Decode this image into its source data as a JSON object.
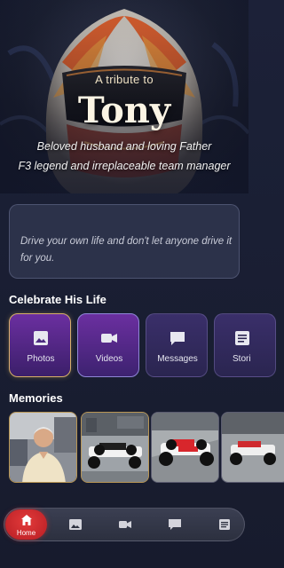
{
  "hero": {
    "kicker": "A tribute to",
    "name": "Tony",
    "line1": "Beloved husband and loving Father",
    "line2": "F3 legend and irreplaceable team manager"
  },
  "quote": {
    "text": "Drive your own life and don't let anyone drive it for you."
  },
  "celebrate": {
    "title": "Celebrate His Life",
    "tiles": [
      {
        "label": "Photos",
        "icon": "photo-icon"
      },
      {
        "label": "Videos",
        "icon": "video-icon"
      },
      {
        "label": "Messages",
        "icon": "message-icon"
      },
      {
        "label": "Stori",
        "icon": "stories-icon"
      }
    ]
  },
  "memories": {
    "title": "Memories",
    "items": [
      {
        "icon": "portrait-photo"
      },
      {
        "icon": "race-car-photo"
      },
      {
        "icon": "race-car-photo"
      },
      {
        "icon": "race-car-photo"
      }
    ]
  },
  "nav": {
    "home_label": "Home",
    "items": [
      "home-icon",
      "photo-icon",
      "video-icon",
      "message-icon",
      "stories-icon"
    ]
  },
  "colors": {
    "background": "#1a1f34",
    "accent_gold": "#d7b067",
    "accent_purple": "#6b2fa0",
    "home_red": "#d22b2f"
  }
}
